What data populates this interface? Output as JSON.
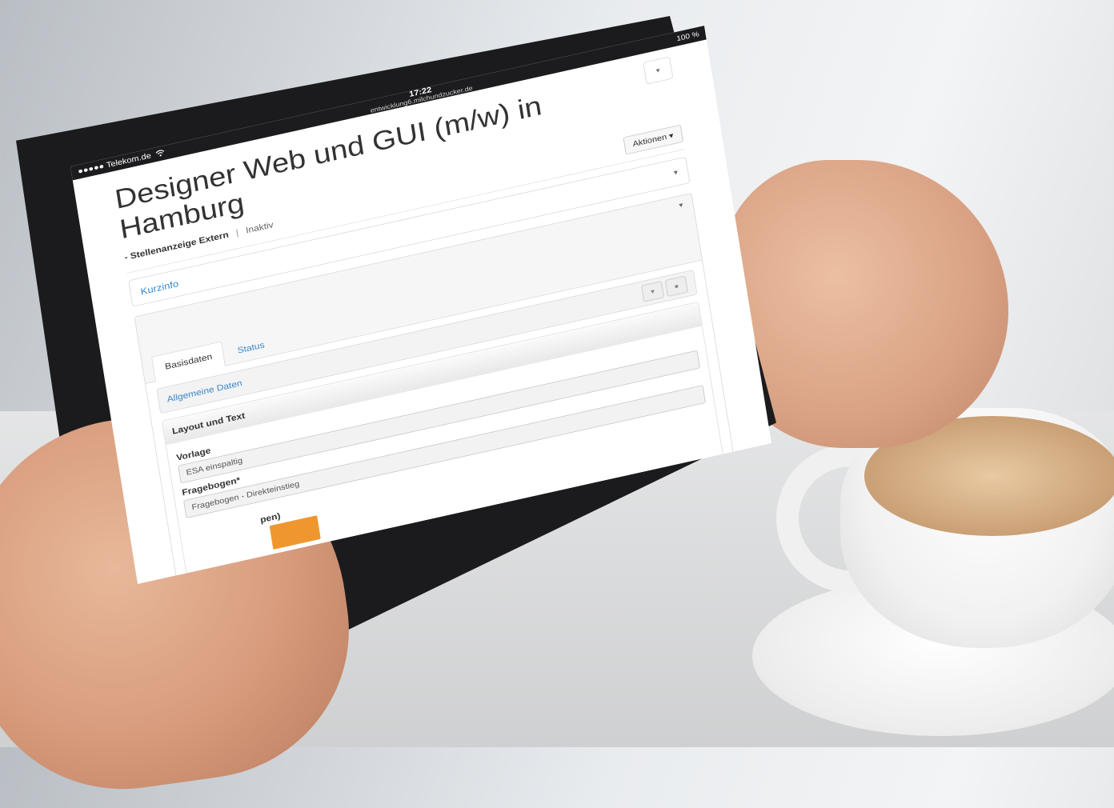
{
  "status_bar": {
    "carrier": "●●●●● Telekom.de",
    "wifi_icon": "wifi-icon",
    "time": "17:22",
    "url": "entwicklung6.milchundzucker.de",
    "battery": "100 %"
  },
  "header": {
    "title": "Designer Web und GUI (m/w) in Hamburg",
    "subtitle_type": "- Stellenanzeige Extern",
    "separator": "|",
    "subtitle_status": "Inaktiv",
    "actions_button": "Aktionen ▾"
  },
  "panels": {
    "kurzinfo": "Kurzinfo"
  },
  "tabs": [
    {
      "label": "Basisdaten",
      "active": true
    },
    {
      "label": "Status",
      "active": false
    }
  ],
  "collapse": {
    "allgemeine": "Allgemeine Daten"
  },
  "layout_section": {
    "heading": "Layout und Text",
    "vorlage_label": "Vorlage",
    "vorlage_value": "ESA einspaltig",
    "fragebogen_label": "Fragebogen*",
    "fragebogen_value": "Fragebogen - Direkteinstieg",
    "partial_label": "pen)"
  },
  "colors": {
    "link": "#3a87c5",
    "accent_orange": "#f0962f"
  }
}
